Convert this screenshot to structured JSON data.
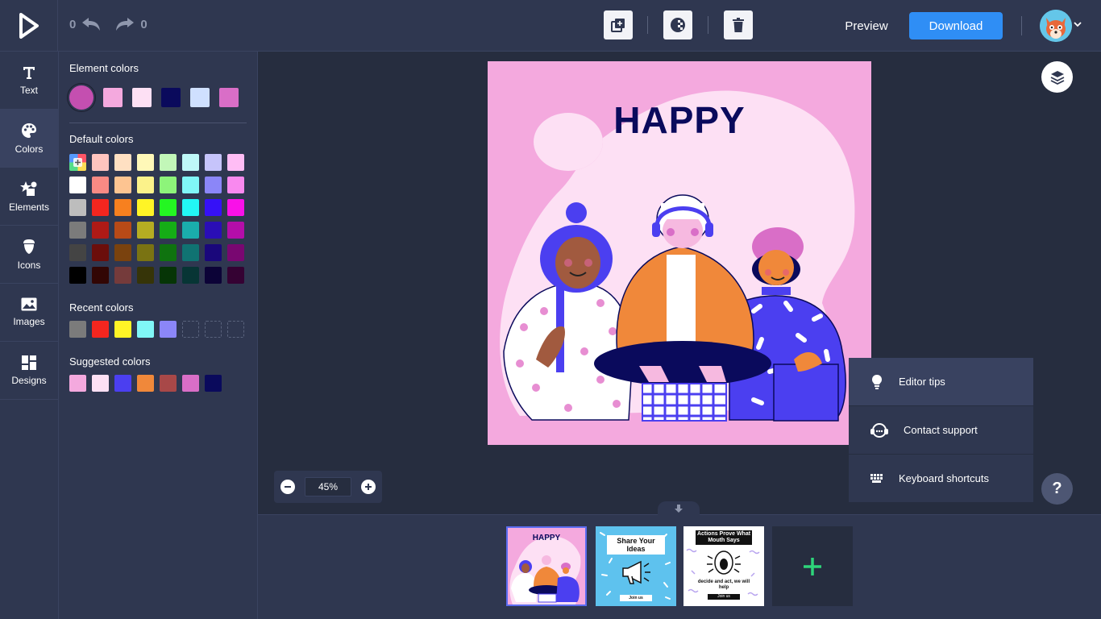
{
  "toolbar": {
    "undo_count": "0",
    "redo_count": "0",
    "preview_label": "Preview",
    "download_label": "Download"
  },
  "nav": [
    {
      "label": "Text",
      "icon": "text-icon"
    },
    {
      "label": "Colors",
      "icon": "palette-icon"
    },
    {
      "label": "Elements",
      "icon": "shapes-icon"
    },
    {
      "label": "Icons",
      "icon": "acorn-icon"
    },
    {
      "label": "Images",
      "icon": "image-icon"
    },
    {
      "label": "Designs",
      "icon": "grid-icon"
    }
  ],
  "panel": {
    "element_title": "Element colors",
    "element_colors": [
      "#c44fb0",
      "#f4a9de",
      "#fde0f4",
      "#0a0a5c",
      "#cfe0ff",
      "#d96ec7"
    ],
    "default_title": "Default colors",
    "default_colors": [
      "#picker",
      "#ffc4bf",
      "#ffe0c2",
      "#fff8b8",
      "#c2f7b8",
      "#bff8f8",
      "#c6c4fb",
      "#ffbdf5",
      "#ffffff",
      "#f98a84",
      "#fdc491",
      "#fbf28a",
      "#8df47a",
      "#80f7f7",
      "#8b86f8",
      "#f989ef",
      "#bdbdbd",
      "#f4261f",
      "#f7801f",
      "#fff426",
      "#24f622",
      "#22f7f5",
      "#3611f7",
      "#f911e8",
      "#7b7b7b",
      "#ae1a16",
      "#b84a17",
      "#b5ad22",
      "#15ad16",
      "#1aadac",
      "#2a0eb6",
      "#b40ea9",
      "#444444",
      "#6b0e0b",
      "#7a420e",
      "#7a7312",
      "#0f730f",
      "#107372",
      "#1a077b",
      "#790771",
      "#000000",
      "#320604",
      "#753b3b",
      "#363408",
      "#063506",
      "#073535",
      "#0c0337",
      "#350233"
    ],
    "recent_title": "Recent colors",
    "recent_colors": [
      "#7b7b7b",
      "#f4261f",
      "#fff426",
      "#80f7f7",
      "#8b86f8"
    ],
    "suggested_title": "Suggested colors",
    "suggested_colors": [
      "#f4a9de",
      "#fde0f4",
      "#4b3ff0",
      "#f0883a",
      "#a84848",
      "#d96ec7",
      "#0a0a5c"
    ]
  },
  "canvas": {
    "title": "HAPPY"
  },
  "zoom": {
    "value": "45%"
  },
  "help_menu": [
    {
      "label": "Editor tips",
      "icon": "bulb-icon"
    },
    {
      "label": "Contact support",
      "icon": "headset-icon"
    },
    {
      "label": "Keyboard shortcuts",
      "icon": "keyboard-icon"
    }
  ],
  "help_button": "?",
  "pages": [
    {
      "title": "HAPPY"
    },
    {
      "title": "Share Your Ideas",
      "cta": "Join us"
    },
    {
      "title": "Actions Prove What Mouth Says",
      "subtitle": "decide and act, we will help",
      "cta": "Join us"
    }
  ]
}
